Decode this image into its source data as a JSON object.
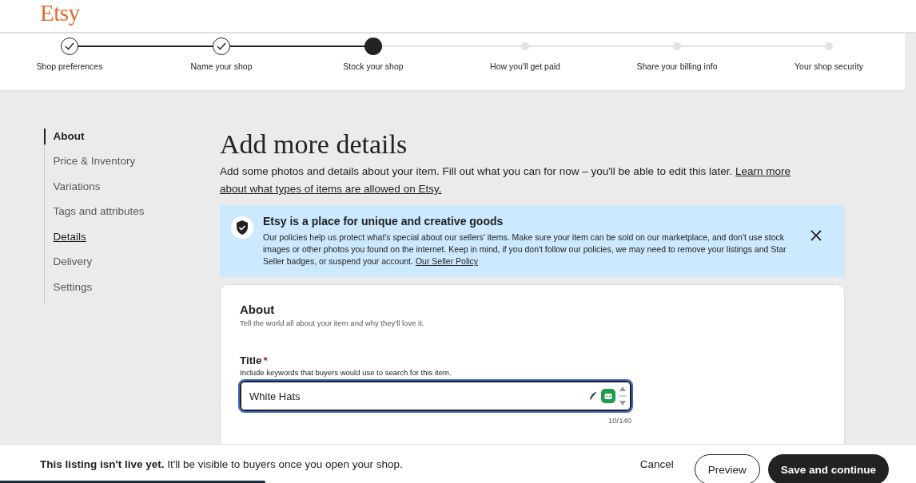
{
  "logo": "Etsy",
  "steps": [
    {
      "label": "Shop preferences",
      "completed": true,
      "current": false
    },
    {
      "label": "Name your shop",
      "completed": true,
      "current": false
    },
    {
      "label": "Stock your shop",
      "completed": false,
      "current": true
    },
    {
      "label": "How you'll get paid",
      "completed": false,
      "current": false
    },
    {
      "label": "Share your billing info",
      "completed": false,
      "current": false
    },
    {
      "label": "Your shop security",
      "completed": false,
      "current": false
    }
  ],
  "sidebar": {
    "items": [
      {
        "label": "About",
        "selected": true,
        "hovered": false
      },
      {
        "label": "Price & Inventory",
        "selected": false,
        "hovered": false
      },
      {
        "label": "Variations",
        "selected": false,
        "hovered": false
      },
      {
        "label": "Tags and attributes",
        "selected": false,
        "hovered": false
      },
      {
        "label": "Details",
        "selected": false,
        "hovered": true
      },
      {
        "label": "Delivery",
        "selected": false,
        "hovered": false
      },
      {
        "label": "Settings",
        "selected": false,
        "hovered": false
      }
    ]
  },
  "heading": "Add more details",
  "intro": {
    "text": "Add some photos and details about your item. Fill out what you can for now – you'll be able to edit this later.",
    "link_lines": [
      "Learn more",
      "about what types of items are allowed on Etsy."
    ]
  },
  "notice": {
    "title": "Etsy is a place for unique and creative goods",
    "body": "Our policies help us protect what's special about our sellers' items. Make sure your item can be sold on our marketplace, and don't use stock images or other photos you found on the internet. Keep in mind, if you don't follow our policies, we may need to remove your listings and Star Seller badges, or suspend your account.",
    "link": "Our Seller Policy"
  },
  "about_card": {
    "title": "About",
    "subtitle": "Tell the world all about your item and why they'll love it.",
    "title_field": {
      "label": "Title",
      "required": "*",
      "hint": "Include keywords that buyers would use to search for this item.",
      "value": "White Hats",
      "counter": "10/140"
    }
  },
  "footer": {
    "message": "**This listing isn't live yet.** It'll be visible to buyers once you open your shop.",
    "buttons": [
      {
        "label": "Cancel",
        "kind": "text"
      },
      {
        "label": "Preview",
        "kind": "outline"
      },
      {
        "label": "Save and continue",
        "kind": "primary"
      }
    ],
    "progress": {
      "level": 0.29
    }
  }
}
